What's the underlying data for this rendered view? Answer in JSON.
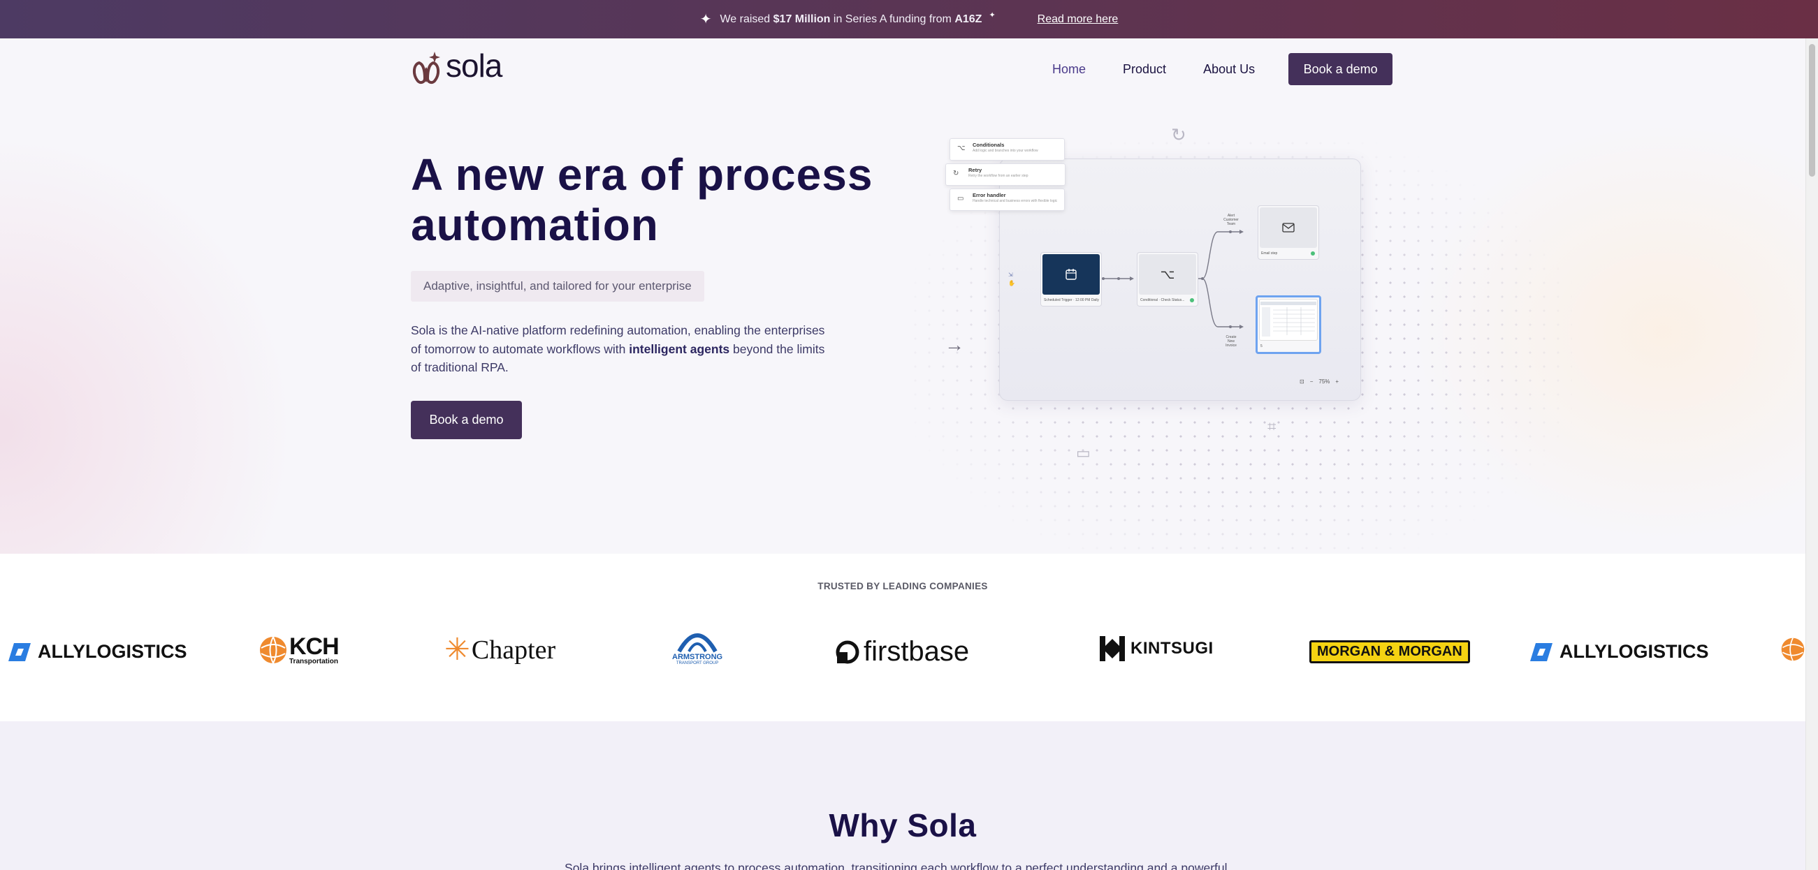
{
  "announcement": {
    "prefix": "We raised",
    "amount": "$17 Million",
    "middle": "in Series A funding from",
    "investor": "A16Z",
    "link": "Read more here"
  },
  "nav": {
    "brand": "sola",
    "items": [
      {
        "label": "Home",
        "active": true
      },
      {
        "label": "Product",
        "active": false
      },
      {
        "label": "About Us",
        "active": false
      }
    ],
    "cta": "Book a demo"
  },
  "hero": {
    "title_line1": "A new era of process",
    "title_line2": "automation",
    "tagline": "Adaptive, insightful, and tailored for your enterprise",
    "desc_pre": "Sola is the AI-native platform redefining automation, enabling the enterprises of tomorrow to automate workflows with",
    "desc_bold": "intelligent agents",
    "desc_post": "beyond the limits of traditional RPA.",
    "cta": "Book a demo"
  },
  "workflow": {
    "menu": [
      {
        "title": "Conditionals",
        "sub": "Add logic and branches into your workflow",
        "icon": "branch-icon"
      },
      {
        "title": "Retry",
        "sub": "Retry the workflow from an earlier step",
        "icon": "retry-icon"
      },
      {
        "title": "Error handler",
        "sub": "Handle technical and business errors with flexible logic",
        "icon": "error-icon"
      }
    ],
    "nodes": {
      "trigger": "Scheduled Trigger · 12:00 PM Daily",
      "condition": "Conditional · Check Status...",
      "email": "Email step",
      "screen": "5"
    },
    "branch_top": "Alert Customer Team",
    "branch_bottom": "Create New Invoice",
    "zoom": "75%"
  },
  "trusted": {
    "label": "TRUSTED BY LEADING COMPANIES",
    "logos": [
      "ALLYLOGISTICS",
      "KCH",
      "Transportation",
      "Chapter",
      "ARMSTRONG",
      "TRANSPORT GROUP",
      "firstbase",
      "KINTSUGI",
      "MORGAN & MORGAN",
      "ALLYLOGISTICS"
    ]
  },
  "why": {
    "title": "Why Sola",
    "text": "Sola brings intelligent agents to process automation, transitioning each workflow to a perfect understanding and a powerful ..."
  },
  "colors": {
    "primary": "#44305a",
    "heading": "#1a1147",
    "accent": "#4a3a8a"
  }
}
